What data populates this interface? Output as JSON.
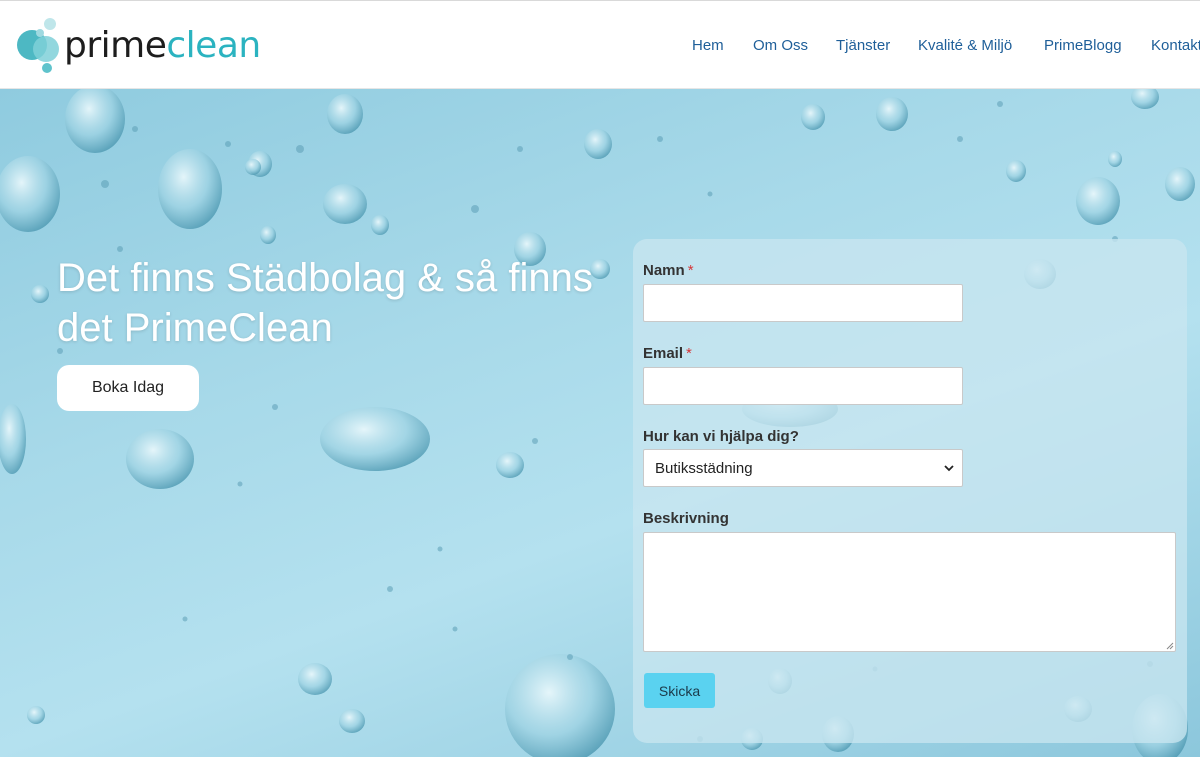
{
  "brand": {
    "name_part1": "prime",
    "name_part2": "clean",
    "accent_color": "#2bb3c0"
  },
  "nav": {
    "items": [
      {
        "label": "Hem"
      },
      {
        "label": "Om Oss"
      },
      {
        "label": "Tjänster"
      },
      {
        "label": "Kvalité & Miljö"
      },
      {
        "label": "PrimeBlogg"
      },
      {
        "label": "Kontakt"
      }
    ],
    "link_color": "#1f5f99"
  },
  "hero": {
    "title": "Det finns Städbolag & så finns det PrimeClean",
    "cta_label": "Boka Idag"
  },
  "form": {
    "name_label": "Namn",
    "email_label": "Email",
    "required_marker": "*",
    "help_label": "Hur kan vi hjälpa dig?",
    "help_selected": "Butiksstädning",
    "description_label": "Beskrivning",
    "name_value": "",
    "email_value": "",
    "description_value": "",
    "submit_label": "Skicka",
    "submit_color": "#5ad2f0"
  },
  "icons": {
    "logo": "bubbles-logo-icon",
    "select": "chevron-down-icon",
    "textarea": "resize-grip-icon"
  }
}
